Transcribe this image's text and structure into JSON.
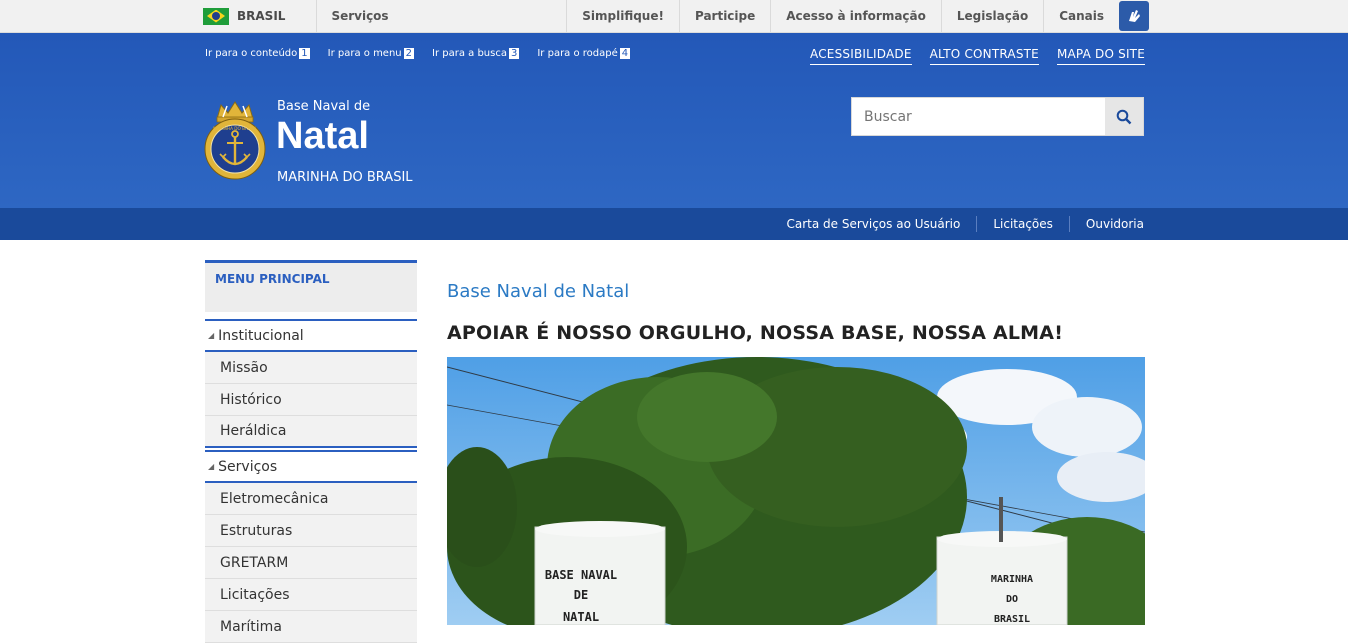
{
  "gov_bar": {
    "country": "BRASIL",
    "services": "Serviços",
    "links": [
      "Simplifique!",
      "Participe",
      "Acesso à informação",
      "Legislação",
      "Canais"
    ]
  },
  "access": {
    "skip_links": [
      {
        "label": "Ir para o conteúdo",
        "key": "1"
      },
      {
        "label": "Ir para o menu",
        "key": "2"
      },
      {
        "label": "Ir para a busca",
        "key": "3"
      },
      {
        "label": "Ir para o rodapé",
        "key": "4"
      }
    ],
    "accessibility": "ACESSIBILIDADE",
    "contrast": "ALTO CONTRASTE",
    "sitemap": "MAPA DO SITE"
  },
  "brand": {
    "pre": "Base Naval de",
    "name": "Natal",
    "org": "MARINHA DO BRASIL",
    "logo_text": "MARINHA DO BRASIL"
  },
  "search": {
    "placeholder": "Buscar"
  },
  "service_bar": [
    "Carta de Serviços ao Usuário",
    "Licitações",
    "Ouvidoria"
  ],
  "sidebar": {
    "title": "MENU PRINCIPAL",
    "sections": [
      {
        "label": "Institucional",
        "items": [
          "Missão",
          "Histórico",
          "Heráldica"
        ]
      },
      {
        "label": "Serviços",
        "items": [
          "Eletromecânica",
          "Estruturas",
          "GRETARM",
          "Licitações",
          "Marítima"
        ]
      }
    ]
  },
  "content": {
    "title": "Base Naval de Natal",
    "headline": "APOIAR É NOSSO ORGULHO, NOSSA BASE, NOSSA ALMA!",
    "sign_left": [
      "BASE NAVAL",
      "DE",
      "NATAL"
    ],
    "sign_right": [
      "MARINHA",
      "DO",
      "BRASIL"
    ]
  },
  "colors": {
    "header_blue": "#2358b8",
    "service_bar": "#1a4a9b",
    "accent": "#2b5fc0",
    "title_blue": "#2b7ac4"
  }
}
